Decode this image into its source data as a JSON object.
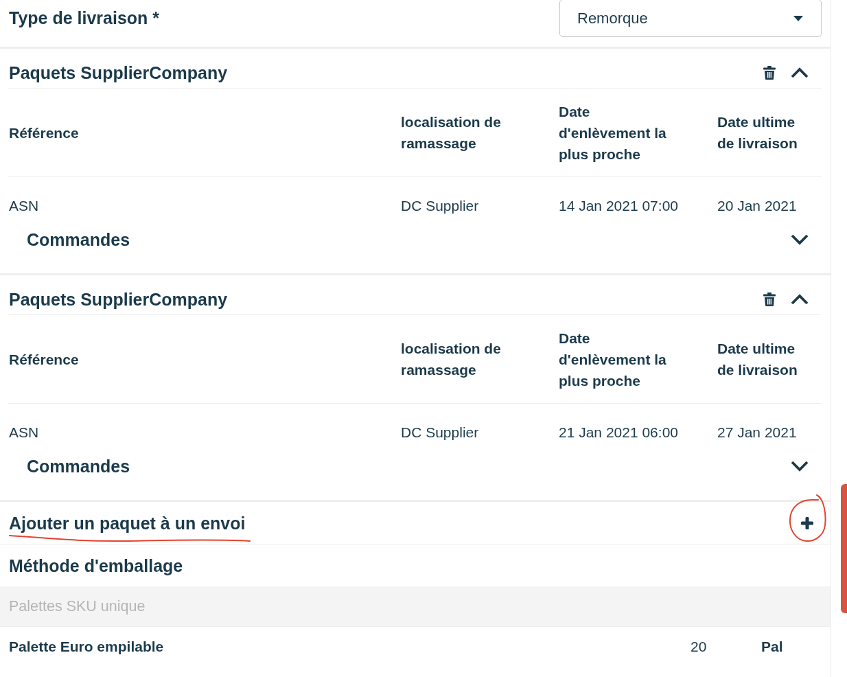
{
  "delivery_type": {
    "label": "Type de livraison *",
    "value": "Remorque"
  },
  "packages": [
    {
      "title": "Paquets SupplierCompany",
      "expanded": true,
      "columns": [
        "Référence",
        "localisation de ramassage",
        "Date d'enlèvement la plus proche",
        "Date ultime de livraison"
      ],
      "rows": [
        {
          "cells": [
            "ASN",
            "DC Supplier",
            "14 Jan 2021 07:00",
            "20 Jan 2021"
          ],
          "orders": {
            "label": "Commandes",
            "expanded": false
          }
        }
      ]
    },
    {
      "title": "Paquets SupplierCompany",
      "expanded": true,
      "columns": [
        "Référence",
        "localisation de ramassage",
        "Date d'enlèvement la plus proche",
        "Date ultime de livraison"
      ],
      "rows": [
        {
          "cells": [
            "ASN",
            "DC Supplier",
            "21 Jan 2021 06:00",
            "27 Jan 2021"
          ],
          "orders": {
            "label": "Commandes",
            "expanded": false
          }
        }
      ]
    }
  ],
  "add_package": {
    "label": "Ajouter un paquet à un envoi",
    "annotated": true
  },
  "packing_method": {
    "title": "Méthode d'emballage",
    "groups": [
      {
        "label": "Palettes SKU unique",
        "items": [
          {
            "name": "Palette Euro empilable",
            "quantity": "20",
            "unit": "Pal"
          }
        ]
      }
    ]
  }
}
